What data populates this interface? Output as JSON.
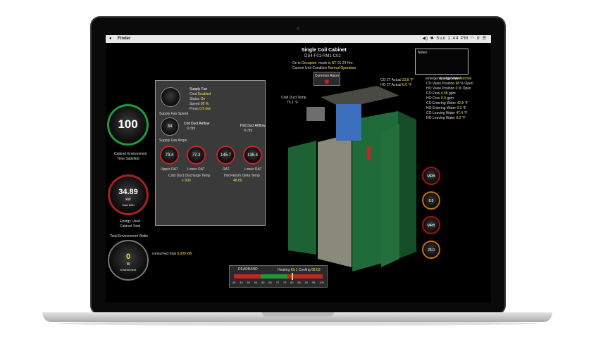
{
  "menubar": {
    "apple": "",
    "app_name": "Finder",
    "status_right": "◀)  ✱  Sun 1:44 PM  ◠  ⚲  ☰"
  },
  "header": {
    "title": "Single Coil Cabinet",
    "subtitle": "DS4-F01-RM1-C02",
    "status_line_label": "On is",
    "status_line_value": "Occupied",
    "mode_label": "mode is",
    "mode_value": "NT 01",
    "time_unit": "24 Hrs",
    "condition_label": "Current Unit Condition",
    "condition_value": "Normal Operation"
  },
  "notes": {
    "label": "Notes:"
  },
  "emergency": {
    "label": "emergency shutdown",
    "value": "Normal"
  },
  "alarm_button": {
    "label": "Common Alarm"
  },
  "left_gauges": {
    "cabinet_env": {
      "value": "100",
      "label_line1": "Cabinet Environment",
      "label_line2": "Time Satisfied"
    },
    "energy": {
      "value": "34.89",
      "unit": "kW",
      "inner_label": "Total kWh",
      "label_line1": "Energy Used",
      "label_line2": "Cabinet Total"
    },
    "env_watts": {
      "title": "Total Environment Watts",
      "value": "0",
      "unit": "W",
      "inner_label": "Environment"
    },
    "consumed_label": "consumed total",
    "consumed_value": "5,000 kW"
  },
  "panel": {
    "supply_fan": {
      "title": "Supply Fan",
      "rows": [
        {
          "k": "Cmd",
          "v": "Enabled"
        },
        {
          "k": "Status",
          "v": "On"
        },
        {
          "k": "Speed",
          "v": "80 %"
        },
        {
          "k": "Press",
          "v": "0.5 inw"
        }
      ],
      "gauge_label": "Supply Fan Speed"
    },
    "coil_duct": {
      "title": "Coil Duct Airflow",
      "value": "0 cfm",
      "gauge_value": "34"
    },
    "hot_duct": {
      "title": "Hot Duct Airflow",
      "value": "0 cfm"
    },
    "fan_amps_label": "Supply Fan Amps",
    "temps": [
      {
        "value": "73.4",
        "label": "Upper DAT"
      },
      {
        "value": "77.3",
        "label": "Lower DAT"
      },
      {
        "value": "145.7",
        "label": "RAT"
      },
      {
        "value": "135.4",
        "label": "Lower RAT"
      }
    ],
    "cold_setpoint_label": "Cold Duct Discharge Temp",
    "cold_setpoint_value": "< 600",
    "hot_setpoint_label": "Hot Return Delta Temp",
    "hot_setpoint_value": "48.00"
  },
  "cabinet": {
    "cold_duct_temp_label": "Cold Duct Temp",
    "cold_duct_temp_value": "73.1 °F",
    "co2_label": "CO 2T Actual",
    "co2_value": "33.8 °F",
    "h2o_label": "HO 2T Actual",
    "h2o_value": "0.0 °F"
  },
  "energy_valve": {
    "title": "Energy Valve",
    "rows": [
      {
        "k": "CO Valve Position",
        "v": "98",
        "u": "% Open"
      },
      {
        "k": "HO Valve Position",
        "v": "0",
        "u": "% Open"
      },
      {
        "k": "CO Flow",
        "v": "4.58",
        "u": "gpm"
      },
      {
        "k": "HO Flow",
        "v": "0.0",
        "u": "gpm"
      },
      {
        "k": "CO Entering Water",
        "v": "42.8",
        "u": "°F"
      },
      {
        "k": "HO Entering Water",
        "v": "0.0",
        "u": "°F"
      },
      {
        "k": "CO Leaving Water",
        "v": "47.4",
        "u": "°F"
      },
      {
        "k": "HO Leaving Water",
        "v": "0.0",
        "u": "°F"
      }
    ]
  },
  "right_gauges": [
    {
      "value": "MRB",
      "color": "#a21414"
    },
    {
      "value": "6.0",
      "color": "#c0700c"
    },
    {
      "value": "MRB",
      "color": "#a21414"
    },
    {
      "value": "26.0",
      "color": "#c0700c"
    }
  ],
  "heating_bar": {
    "deadband_label": "DEADBAND",
    "heating_label": "Heating",
    "heating_value": "69.1",
    "cooling_label": "Cooling",
    "cooling_value": "68.03",
    "scale": [
      "40",
      "45",
      "50",
      "55",
      "60",
      "65",
      "70",
      "75",
      "80",
      "85",
      "90",
      "95",
      "100"
    ],
    "marker_fraction": 0.65
  },
  "colors": {
    "green": "#1f6b3a",
    "accent_yellow": "#f2e04b",
    "accent_green": "#55d36b",
    "gauge_red": "#c62525"
  }
}
